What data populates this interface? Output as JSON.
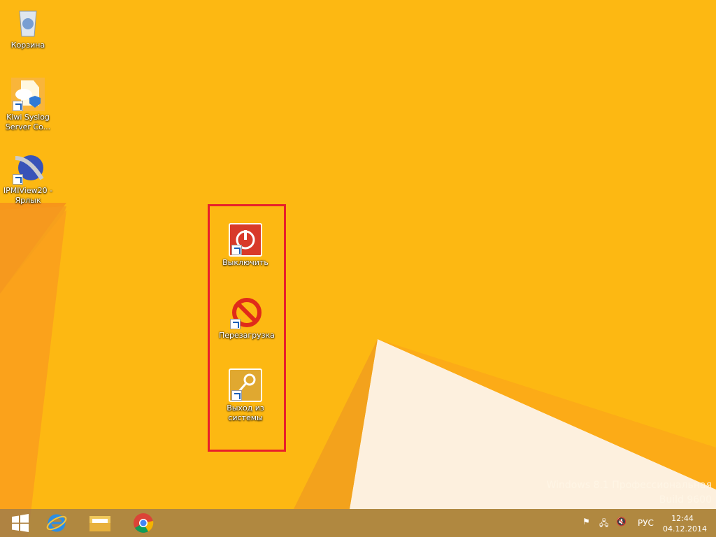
{
  "desktop": {
    "icons": [
      {
        "label": "Корзина"
      },
      {
        "label": "Kiwi Syslog Server Co..."
      },
      {
        "label": "IPMIView20 - Ярлык"
      },
      {
        "label": "Выключить"
      },
      {
        "label": "Перезагрузка"
      },
      {
        "label": "Выход из системы"
      }
    ]
  },
  "watermark": {
    "line1": "Windows 8.1 Профессиональная",
    "line2": "Build 9600"
  },
  "taskbar": {
    "language": "РУС",
    "time": "12:44",
    "date": "04.12.2014"
  },
  "colors": {
    "background": "#fdb812",
    "highlight": "#e8202a"
  }
}
